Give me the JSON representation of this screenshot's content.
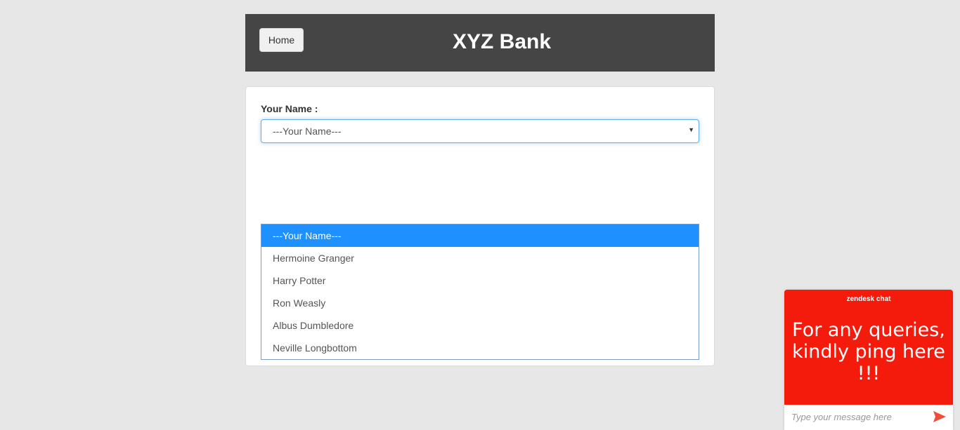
{
  "header": {
    "home_label": "Home",
    "title": "XYZ Bank"
  },
  "form": {
    "name_label": "Your Name :",
    "select_value": "---Your Name---",
    "options": [
      "---Your Name---",
      "Hermoine Granger",
      "Harry Potter",
      "Ron Weasly",
      "Albus Dumbledore",
      "Neville Longbottom"
    ],
    "selected_index": 0,
    "select_arrow": "▼"
  },
  "chat": {
    "brand": "zendesk chat",
    "message": "For any queries, kindly ping here !!!",
    "input_placeholder": "Type your message here",
    "send_icon": "send-icon",
    "color": "#f41a0c"
  },
  "colors": {
    "header_bg": "#454545",
    "option_highlight": "#1e90ff",
    "page_bg": "#e7e7e7"
  }
}
